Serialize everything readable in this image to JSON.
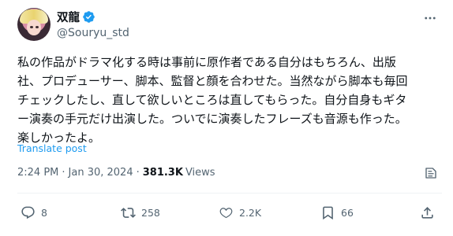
{
  "author": {
    "display_name": "双龍",
    "handle": "@Souryu_std",
    "verified": true
  },
  "tweet": {
    "text": "私の作品がドラマ化する時は事前に原作者である自分はもちろん、出版\n社、プロデューサー、脚本、監督と顔を合わせた。当然ながら脚本も毎回\nチェックしたし、直して欲しいところは直してもらった。自分自身もギタ\nー演奏の手元だけ出演した。ついでに演奏したフレーズも音源も作った。\n楽しかったよ。",
    "translate_label": "Translate post"
  },
  "meta": {
    "time": "2:24 PM",
    "separator": "·",
    "date": "Jan 30, 2024",
    "views_count": "381.3K",
    "views_label": "Views"
  },
  "actions": {
    "replies": "8",
    "reposts": "258",
    "likes": "2.2K",
    "bookmarks": "66"
  },
  "colors": {
    "accent": "#1d9bf0",
    "text": "#0f1419",
    "secondary": "#536471"
  },
  "icons": [
    "verified-badge-icon",
    "more-icon",
    "grok-icon",
    "reply-icon",
    "repost-icon",
    "like-icon",
    "bookmark-icon",
    "share-icon"
  ]
}
